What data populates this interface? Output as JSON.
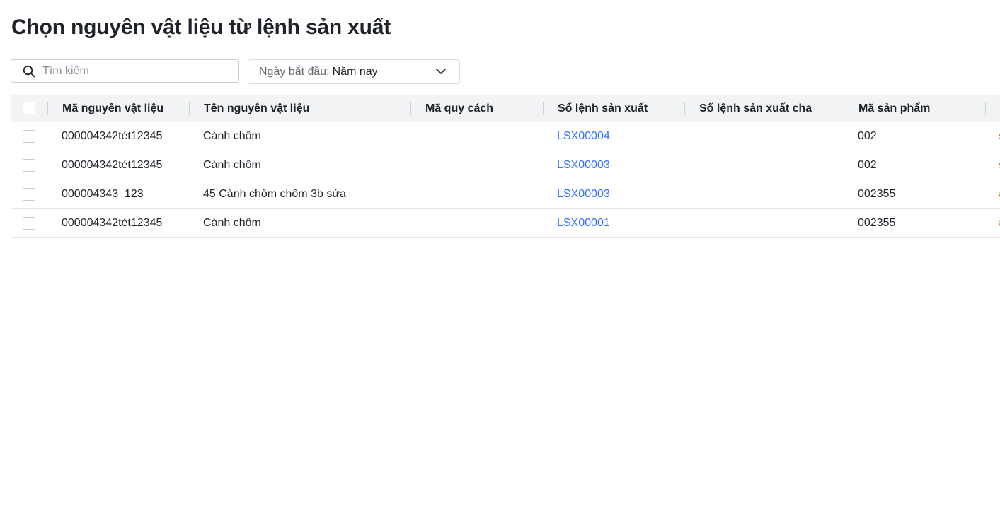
{
  "page": {
    "title": "Chọn nguyên vật liệu từ lệnh sản xuất"
  },
  "search": {
    "placeholder": "Tìm kiếm",
    "value": ""
  },
  "date_filter": {
    "label": "Ngày bắt đầu:",
    "value": "Năm nay"
  },
  "table": {
    "columns": [
      "Mã nguyên vật liệu",
      "Tên nguyên vật liệu",
      "Mã quy cách",
      "Số lệnh sản xuất",
      "Số lệnh sản xuất cha",
      "Mã sản phẩm"
    ],
    "rows": [
      {
        "material_code": "000004342tét12345",
        "material_name": "Cành chôm",
        "spec_code": "",
        "order_no": "LSX00004",
        "parent_order_no": "",
        "product_code": "002",
        "next_col": "s"
      },
      {
        "material_code": "000004342tét12345",
        "material_name": "Cành chôm",
        "spec_code": "",
        "order_no": "LSX00003",
        "parent_order_no": "",
        "product_code": "002",
        "next_col": "s"
      },
      {
        "material_code": "000004343_123",
        "material_name": "45 Cành chôm chôm 3b sửa",
        "spec_code": "",
        "order_no": "LSX00003",
        "parent_order_no": "",
        "product_code": "002355",
        "next_col": "a"
      },
      {
        "material_code": "000004342tét12345",
        "material_name": "Cành chôm",
        "spec_code": "",
        "order_no": "LSX00001",
        "parent_order_no": "",
        "product_code": "002355",
        "next_col": "a"
      }
    ]
  },
  "colors": {
    "link": "#3370ff",
    "header_bg": "#f2f3f5",
    "border": "#dee0e3"
  }
}
